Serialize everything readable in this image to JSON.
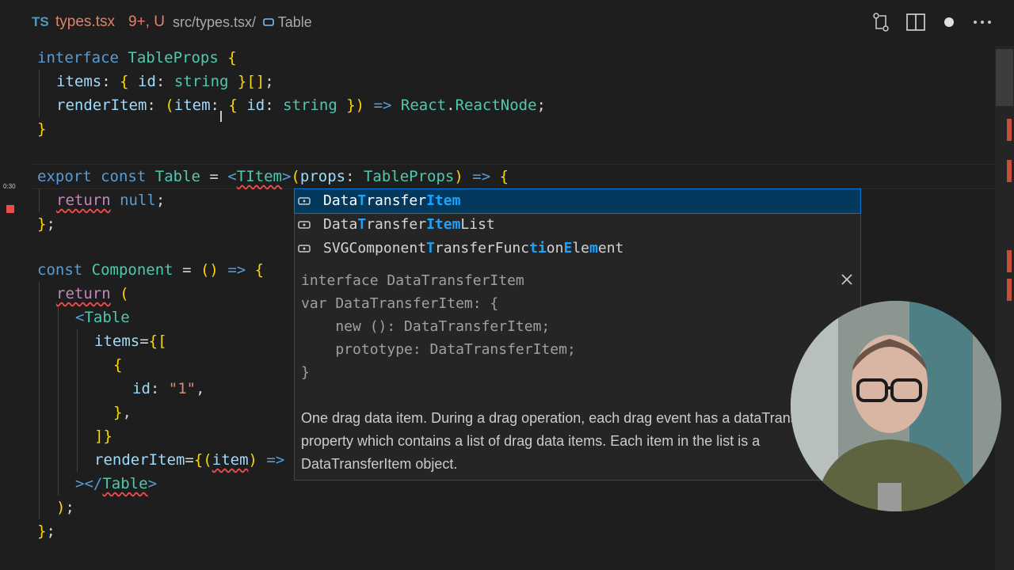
{
  "titlebar": {
    "lang_badge": "TS",
    "file_name": "types.tsx",
    "file_status": "9+, U",
    "breadcrumb_path": "src/types.tsx/",
    "breadcrumb_symbol": "Table",
    "icons": [
      "compare-changes-icon",
      "split-editor-icon",
      "unsaved-dot-icon",
      "more-actions-icon"
    ]
  },
  "editor": {
    "timestamp": "0:30",
    "lines": [
      {
        "kw": "interface",
        "name": "TableProps",
        "rest": " {"
      },
      {
        "text": "items: { id: string }[];"
      },
      {
        "text": "renderItem: (item: { id: string }) => React.ReactNode;"
      },
      {
        "text": "}"
      },
      {
        "text": "export const Table = <TItem>(props: TableProps) => {"
      },
      {
        "text": "return null;"
      },
      {
        "text": "};"
      },
      {
        "text": "const Component = () => {"
      },
      {
        "text": "return ("
      },
      {
        "text": "<Table"
      },
      {
        "text": "items={["
      },
      {
        "text": "{"
      },
      {
        "text": "id: \"1\","
      },
      {
        "text": "},"
      },
      {
        "text": "]}"
      },
      {
        "text": "renderItem={(item) =>"
      },
      {
        "text": "></Table>"
      },
      {
        "text": ");"
      },
      {
        "text": "};"
      }
    ]
  },
  "suggest": {
    "items": [
      {
        "parts": [
          [
            "Data",
            ""
          ],
          [
            "T",
            "hl"
          ],
          [
            "ransfer",
            ""
          ],
          [
            "Item",
            "hl"
          ]
        ],
        "selected": true
      },
      {
        "parts": [
          [
            "Data",
            ""
          ],
          [
            "T",
            "hl"
          ],
          [
            "ransfer",
            ""
          ],
          [
            "Item",
            "hl"
          ],
          [
            "List",
            ""
          ]
        ],
        "selected": false
      },
      {
        "parts": [
          [
            "SVGComponent",
            ""
          ],
          [
            "T",
            "hl"
          ],
          [
            "ransferFunc",
            ""
          ],
          [
            "ti",
            "hl"
          ],
          [
            "on",
            ""
          ],
          [
            "E",
            "hl"
          ],
          [
            "le",
            ""
          ],
          [
            "m",
            "hl"
          ],
          [
            "ent",
            ""
          ]
        ],
        "selected": false
      }
    ],
    "icon": "symbol-interface-icon"
  },
  "details": {
    "signature": [
      "interface DataTransferItem",
      "var DataTransferItem: {",
      "    new (): DataTransferItem;",
      "    prototype: DataTransferItem;",
      "}"
    ],
    "doc": "One drag data item. During a drag operation, each drag event has a dataTransfer property which contains a list of drag data items. Each item in the list is a DataTransferItem object."
  },
  "colors": {
    "keyword": "#569cd6",
    "type": "#4ec9b0",
    "property": "#9cdcfe",
    "string": "#ce9178",
    "error": "#f14c4c",
    "highlight": "#18a3ff",
    "selection": "#04395e"
  }
}
